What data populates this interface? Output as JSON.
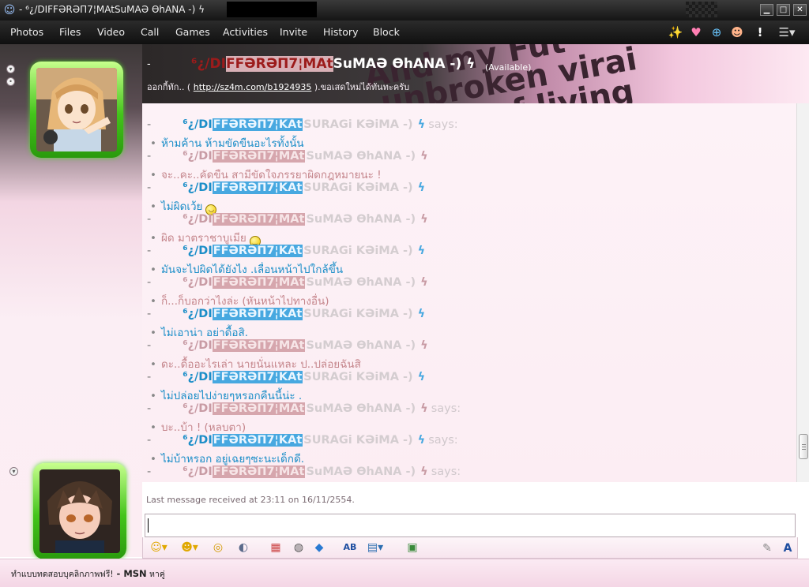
{
  "titlebar": {
    "app_icon": "msn-buddy-icon",
    "title": "- ⁶¿/DIFFƏRƏП7¦MAtSuMAƏ ƟhANA -) ϟ",
    "min": "▁",
    "max": "□",
    "close": "✕"
  },
  "menu": {
    "items": [
      "Photos",
      "Files",
      "Video",
      "Call",
      "Games",
      "Activities",
      "Invite",
      "History",
      "Block"
    ],
    "tool_icons": [
      "wink-wand-icon",
      "heart-icon",
      "search-icon",
      "avatar-face-icon",
      "alert-icon",
      "menu-dropdown-icon"
    ]
  },
  "contact": {
    "dash": "-",
    "name_seg1": "⁶¿/DI",
    "name_seg2": "FFƏRƏП7¦MAt",
    "name_seg3": "SuMAƏ ƟhANA -) ϟ",
    "status": "(Available)",
    "personal_msg_prefix": "ออกกี้ทัก.. (",
    "personal_msg_link": "http://sz4m.com/b1924935",
    "personal_msg_suffix": ").ขอเสดใหม่ได้ทันทะครับ",
    "deco_text": [
      "And my Fut",
      "unbroken virai",
      "of living"
    ]
  },
  "chat": {
    "lines": [
      {
        "kind": "nick",
        "who": "me",
        "prefix": "⁶¿/DI",
        "mid": "FFƏRƏП7¦KAt",
        "rest": "SURAGi KƏiMA -)",
        "zap": "ϟ",
        "says": "says:"
      },
      {
        "kind": "text",
        "who": "me",
        "text": "ห้ามค้าน ห้ามขัดขืนอะไรทั้งนั้น"
      },
      {
        "kind": "nick",
        "who": "her",
        "prefix": "⁶¿/DI",
        "mid": "FFƏRƏП7¦MAt",
        "rest": "SuMAƏ ƟhANA -)",
        "zap": "ϟ",
        "says": ""
      },
      {
        "kind": "text",
        "who": "her",
        "text": "จะ..คะ..คัดขืน สามีขัดใจภรรยาผิดกฎหมายนะ !"
      },
      {
        "kind": "nick",
        "who": "me",
        "prefix": "⁶¿/DI",
        "mid": "FFƏRƏП7¦KAt",
        "rest": "SURAGi KƏiMA -)",
        "zap": "ϟ",
        "says": ""
      },
      {
        "kind": "text",
        "who": "me",
        "text": "ไม่ผิดเว้ย",
        "emoticon": "grin-emoticon"
      },
      {
        "kind": "nick",
        "who": "her",
        "prefix": "⁶¿/DI",
        "mid": "FFƏRƏП7¦MAt",
        "rest": "SuMAƏ ƟhANA -)",
        "zap": "ϟ",
        "says": ""
      },
      {
        "kind": "text",
        "who": "her",
        "text": "ผิด มาตราชาบูเมีย",
        "emoticon": "smile-emoticon"
      },
      {
        "kind": "nick",
        "who": "me",
        "prefix": "⁶¿/DI",
        "mid": "FFƏRƏП7¦KAt",
        "rest": "SURAGi KƏiMA -)",
        "zap": "ϟ",
        "says": ""
      },
      {
        "kind": "text",
        "who": "me",
        "text": "มันจะไปผิดได้ยังไง .เลื่อนหน้าไปใกล้ขึ้น"
      },
      {
        "kind": "nick",
        "who": "her",
        "prefix": "⁶¿/DI",
        "mid": "FFƏRƏП7¦MAt",
        "rest": "SuMAƏ ƟhANA -)",
        "zap": "ϟ",
        "says": ""
      },
      {
        "kind": "text",
        "who": "her",
        "text": "ก็...ก็บอกว่าไงล่ะ (หันหน้าไปทางอื่น)"
      },
      {
        "kind": "nick",
        "who": "me",
        "prefix": "⁶¿/DI",
        "mid": "FFƏRƏП7¦KAt",
        "rest": "SURAGi KƏiMA -)",
        "zap": "ϟ",
        "says": ""
      },
      {
        "kind": "text",
        "who": "me",
        "text": "ไม่เอาน่า อย่าดื้อสิ."
      },
      {
        "kind": "nick",
        "who": "her",
        "prefix": "⁶¿/DI",
        "mid": "FFƏRƏП7¦MAt",
        "rest": "SuMAƏ ƟhANA -)",
        "zap": "ϟ",
        "says": ""
      },
      {
        "kind": "text",
        "who": "her",
        "text": "ดะ..ดื้ออะไรเล่า นายนั่นแหละ ป..ปล่อยฉันสิ"
      },
      {
        "kind": "nick",
        "who": "me",
        "prefix": "⁶¿/DI",
        "mid": "FFƏRƏП7¦KAt",
        "rest": "SURAGi KƏiMA -)",
        "zap": "ϟ",
        "says": ""
      },
      {
        "kind": "text",
        "who": "me",
        "text": "ไม่ปล่อยไปง่ายๆหรอกคืนนี้น่ะ ."
      },
      {
        "kind": "nick",
        "who": "her",
        "prefix": "⁶¿/DI",
        "mid": "FFƏRƏП7¦MAt",
        "rest": "SuMAƏ ƟhANA -)",
        "zap": "ϟ",
        "says": "says:"
      },
      {
        "kind": "text",
        "who": "her",
        "text": "บะ..บ้า ! (หลบตา)"
      },
      {
        "kind": "nick",
        "who": "me",
        "prefix": "⁶¿/DI",
        "mid": "FFƏRƏП7¦KAt",
        "rest": "SURAGi KƏiMA -)",
        "zap": "ϟ",
        "says": "says:"
      },
      {
        "kind": "text",
        "who": "me",
        "text": "ไม่บ้าหรอก อยู่เฉยๆซะนะเด็กดี."
      },
      {
        "kind": "nick",
        "who": "her",
        "prefix": "⁶¿/DI",
        "mid": "FFƏRƏП7¦MAt",
        "rest": "SuMAƏ ƟhANA -)",
        "zap": "ϟ",
        "says": "says:"
      }
    ]
  },
  "last_message": "Last message received at 23:11 on 16/11/2554.",
  "input": {
    "value": ""
  },
  "format_icons": [
    "emoticon-icon",
    "wink-icon",
    "nudge-icon",
    "voice-clip-icon",
    "background-icon",
    "games-icon",
    "shop-icon",
    "font-icon",
    "handwriting-icon",
    "send-file-icon"
  ],
  "statusbar": {
    "prefix": "ทำแบบทดสอบบุคลิกภาพฟรี!",
    "brand": " - MSN",
    "suffix": " หาคู่"
  },
  "colors": {
    "me_name": "#1b8ec8",
    "me_highlight": "#47a8e0",
    "her_name": "#c89ba4",
    "her_highlight": "#d6a6ad",
    "me_text": "#1b8ec8",
    "her_text": "#c5868c"
  }
}
